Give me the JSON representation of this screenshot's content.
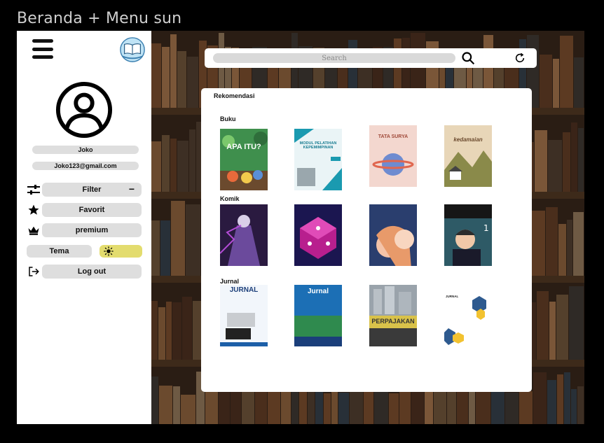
{
  "frame_title": "Beranda + Menu sun",
  "user": {
    "name": "Joko",
    "email": "Joko123@gmail.com"
  },
  "menu": {
    "filter_label": "Filter",
    "filter_toggle": "−",
    "favorit_label": "Favorit",
    "premium_label": "premium",
    "tema_label": "Tema",
    "logout_label": "Log out"
  },
  "search": {
    "placeholder": "Search"
  },
  "panel": {
    "title": "Rekomendasi"
  },
  "sections": {
    "buku": {
      "title": "Buku",
      "covers": [
        {
          "title": "APA ITU?",
          "color": "#3f8f4d"
        },
        {
          "title": "MODUL PELATIHAN KEPEMIMPINAN",
          "color": "#eaf4f6"
        },
        {
          "title": "TATA SURYA",
          "color": "#f3d7cf"
        },
        {
          "title": "kedamaian",
          "color": "#e8d6b8"
        }
      ]
    },
    "komik": {
      "title": "Komik",
      "covers": [
        {
          "title": "",
          "color": "#2a1a40"
        },
        {
          "title": "",
          "color": "#1b1650"
        },
        {
          "title": "",
          "color": "#2a3e6e"
        },
        {
          "title": "",
          "color": "#2e5a66"
        }
      ]
    },
    "jurnal": {
      "title": "Jurnal",
      "covers": [
        {
          "title": "JURNAL",
          "color": "#f2f6fb"
        },
        {
          "title": "Jurnal",
          "color": "#1c6fb5"
        },
        {
          "title": "PERPAJAKAN",
          "color": "#d9c24a"
        },
        {
          "title": "JURNAL",
          "color": "#ffffff"
        }
      ]
    }
  }
}
